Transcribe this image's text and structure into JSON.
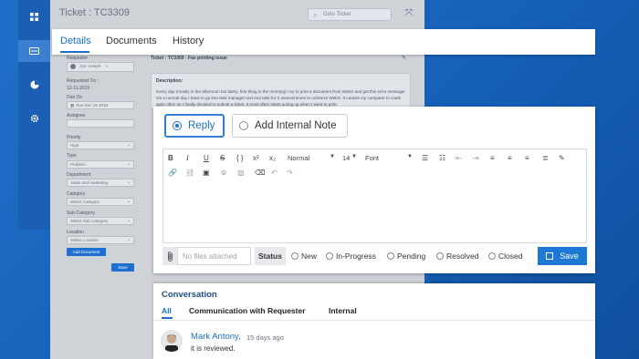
{
  "app": {
    "ticket_title": "Ticket : TC3309",
    "goto_placeholder": "Goto Ticket",
    "ticket_subject": "Ticket : TC3309 - Fax printing issue"
  },
  "sidebar": {
    "items": [
      {
        "icon": "dashboard-icon"
      },
      {
        "icon": "ticket-icon"
      },
      {
        "icon": "pie-chart-icon"
      },
      {
        "icon": "gear-icon"
      }
    ]
  },
  "form": {
    "requester_label": "Requester",
    "requester_value": "Joe Joseph",
    "requested_on_label": "Requested On :",
    "requested_on_value": "12-11-2019",
    "due_on_label": "Due On",
    "due_on_value": "Sun Dec 15 2019",
    "assignee_label": "Assignee",
    "priority_label": "Priority",
    "priority_value": "High",
    "type_label": "Type",
    "type_value": "Problem",
    "department_label": "Department",
    "department_value": "Sales and marketing",
    "category_label": "Category",
    "category_value": "Select Category",
    "subcategory_label": "Sub-Category",
    "subcategory_value": "Select Sub Category",
    "location_label": "Location",
    "location_value": "Select Location",
    "add_document_label": "Add Document",
    "save_label": "Save"
  },
  "description": {
    "label": "Description:",
    "text": "Every day (mostly in the afternoon but lately; first thing in the morning) I try to print a document from WebX and get this error message. On a normal day I have to go into task manager and end task for X several times to unfreeze WebX. It causes my computer to crash quite often so I finally decided to submit a ticket. It most often starts acting up when I want to print."
  },
  "tabs": [
    {
      "label": "Details",
      "active": true
    },
    {
      "label": "Documents",
      "active": false
    },
    {
      "label": "History",
      "active": false
    }
  ],
  "reply": {
    "reply_label": "Reply",
    "note_label": "Add Internal Note",
    "toolbar": {
      "format_value": "Normal",
      "size_value": "14",
      "font_value": "Font"
    },
    "attach_placeholder": "No files attached",
    "status_label": "Status",
    "status_options": [
      "New",
      "In-Progress",
      "Pending",
      "Resolved",
      "Closed"
    ],
    "save_label": "Save",
    "accent_color": "#1d78d6"
  },
  "conversation": {
    "title": "Conversation",
    "tabs": [
      {
        "label": "All",
        "active": true
      },
      {
        "label": "Communication with Requester",
        "active": false
      },
      {
        "label": "Internal",
        "active": false
      }
    ],
    "messages": [
      {
        "author": "Mark Antony,",
        "time": "15 days ago",
        "text": "it is reviewed."
      }
    ]
  }
}
